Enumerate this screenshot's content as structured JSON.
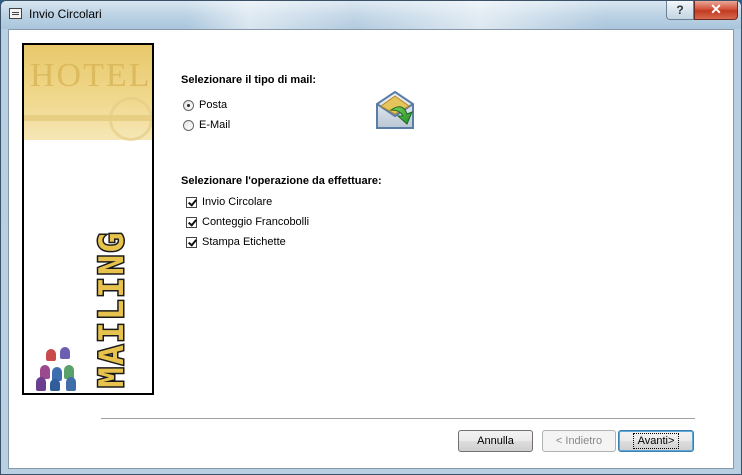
{
  "window": {
    "title": "Invio Circolari",
    "help_label": "?",
    "close_label": "✕"
  },
  "side_panel": {
    "hotel_text": "HOTEL",
    "mailing_text": "MAILING"
  },
  "mail_type": {
    "heading": "Selezionare il tipo di mail:",
    "options": [
      {
        "label": "Posta",
        "selected": true
      },
      {
        "label": "E-Mail",
        "selected": false
      }
    ]
  },
  "operations": {
    "heading": "Selezionare l'operazione da effettuare:",
    "options": [
      {
        "label": "Invio Circolare",
        "checked": true
      },
      {
        "label": "Conteggio Francobolli",
        "checked": true
      },
      {
        "label": "Stampa Etichette",
        "checked": true
      }
    ]
  },
  "buttons": {
    "cancel": "Annulla",
    "back": "< Indietro",
    "next": "Avanti>"
  },
  "icons": {
    "app": "window-icon",
    "mail": "envelope-arrow-icon"
  },
  "colors": {
    "accent_yellow": "#e7c24d",
    "close_red": "#c03a21"
  }
}
